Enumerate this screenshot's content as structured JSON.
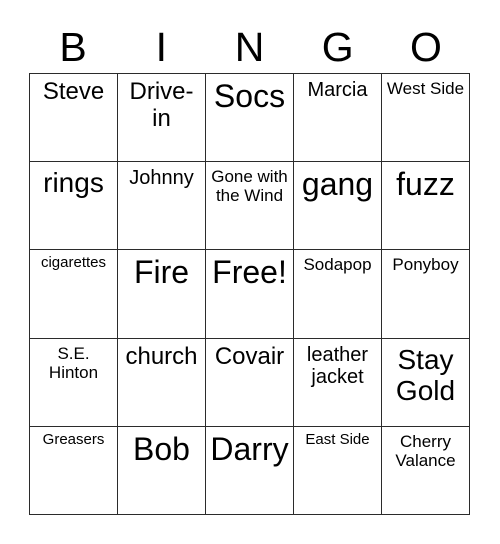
{
  "card": {
    "header_letters": [
      "B",
      "I",
      "N",
      "G",
      "O"
    ],
    "rows": [
      [
        {
          "text": "Steve",
          "size": "lg"
        },
        {
          "text": "Drive-in",
          "size": "lg"
        },
        {
          "text": "Socs",
          "size": "xxl"
        },
        {
          "text": "Marcia",
          "size": "md"
        },
        {
          "text": "West Side",
          "size": "sm"
        }
      ],
      [
        {
          "text": "rings",
          "size": "xl"
        },
        {
          "text": "Johnny",
          "size": "md"
        },
        {
          "text": "Gone with the Wind",
          "size": "sm"
        },
        {
          "text": "gang",
          "size": "xxl"
        },
        {
          "text": "fuzz",
          "size": "xxl"
        }
      ],
      [
        {
          "text": "cigarettes",
          "size": "xs"
        },
        {
          "text": "Fire",
          "size": "xxl"
        },
        {
          "text": "Free!",
          "size": "xxl"
        },
        {
          "text": "Sodapop",
          "size": "sm"
        },
        {
          "text": "Ponyboy",
          "size": "sm"
        }
      ],
      [
        {
          "text": "S.E. Hinton",
          "size": "sm"
        },
        {
          "text": "church",
          "size": "lg"
        },
        {
          "text": "Covair",
          "size": "lg"
        },
        {
          "text": "leather jacket",
          "size": "md"
        },
        {
          "text": "Stay Gold",
          "size": "xl"
        }
      ],
      [
        {
          "text": "Greasers",
          "size": "xs"
        },
        {
          "text": "Bob",
          "size": "xxl"
        },
        {
          "text": "Darry",
          "size": "xxl"
        },
        {
          "text": "East Side",
          "size": "xs"
        },
        {
          "text": "Cherry Valance",
          "size": "sm"
        }
      ]
    ]
  },
  "colors": {
    "background": "#ffffff",
    "text": "#000000",
    "grid_line": "#2b2b2b"
  }
}
